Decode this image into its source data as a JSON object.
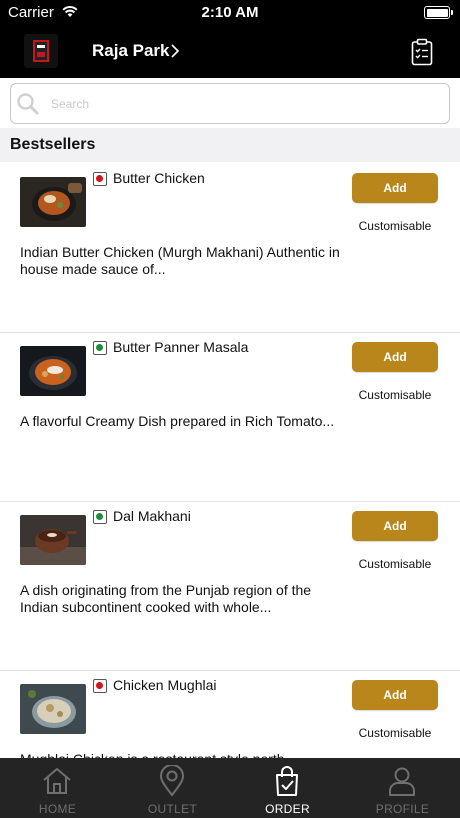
{
  "status_bar": {
    "carrier": "Carrier",
    "time": "2:10 AM"
  },
  "header": {
    "outlet_name": "Raja Park",
    "logo_icon": "restaurant-logo",
    "orders_icon": "clipboard-checklist-icon"
  },
  "search": {
    "placeholder": "Search"
  },
  "section": {
    "title": "Bestsellers"
  },
  "items": [
    {
      "name": "Butter Chicken",
      "type": "non-veg",
      "dot_color": "#d0161c",
      "description": "Indian Butter Chicken (Murgh Makhani) Authentic in house made sauce of...",
      "add_label": "Add",
      "customisable_label": "Customisable"
    },
    {
      "name": "Butter Panner Masala",
      "type": "veg",
      "dot_color": "#1a8f3a",
      "description": "A flavorful Creamy Dish prepared in Rich Tomato...",
      "add_label": "Add",
      "customisable_label": "Customisable"
    },
    {
      "name": "Dal Makhani",
      "type": "veg",
      "dot_color": "#1a8f3a",
      "description": "A dish originating from the Punjab region of the Indian subcontinent cooked with whole...",
      "add_label": "Add",
      "customisable_label": "Customisable"
    },
    {
      "name": "Chicken Mughlai",
      "type": "non-veg",
      "dot_color": "#d0161c",
      "description": "Mughlai Chicken is a restaurant style north...",
      "add_label": "Add",
      "customisable_label": "Customisable"
    }
  ],
  "tabs": [
    {
      "label": "HOME",
      "icon": "home-icon",
      "active": false
    },
    {
      "label": "OUTLET",
      "icon": "location-pin-icon",
      "active": false
    },
    {
      "label": "ORDER",
      "icon": "shopping-bag-icon",
      "active": true
    },
    {
      "label": "PROFILE",
      "icon": "user-icon",
      "active": false
    }
  ],
  "colors": {
    "accent": "#b8861b",
    "header_bg": "#000000",
    "tabbar_bg": "#242424",
    "veg": "#1a8f3a",
    "non_veg": "#d0161c"
  }
}
